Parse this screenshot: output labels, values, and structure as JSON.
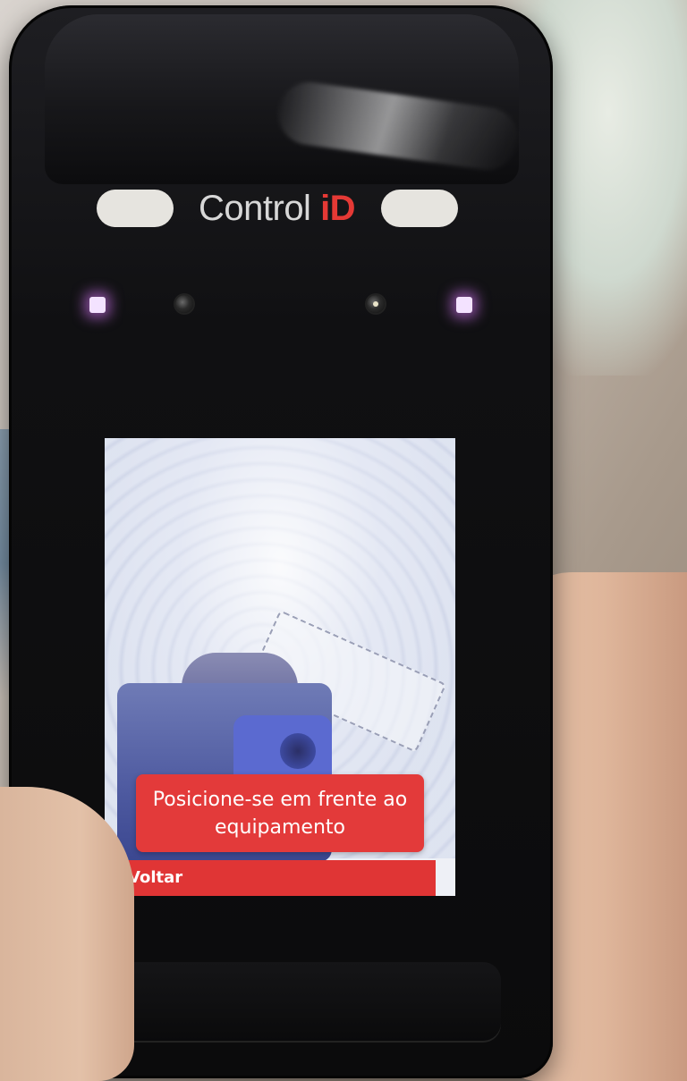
{
  "device": {
    "brand_main": "Control ",
    "brand_accent": "iD"
  },
  "screen": {
    "prompt_text": "Posicione-se em frente ao equipamento",
    "back_label": "Voltar"
  },
  "colors": {
    "accent_red": "#e33a3a",
    "screen_bg": "#eef0f6",
    "device_body": "#101012"
  }
}
